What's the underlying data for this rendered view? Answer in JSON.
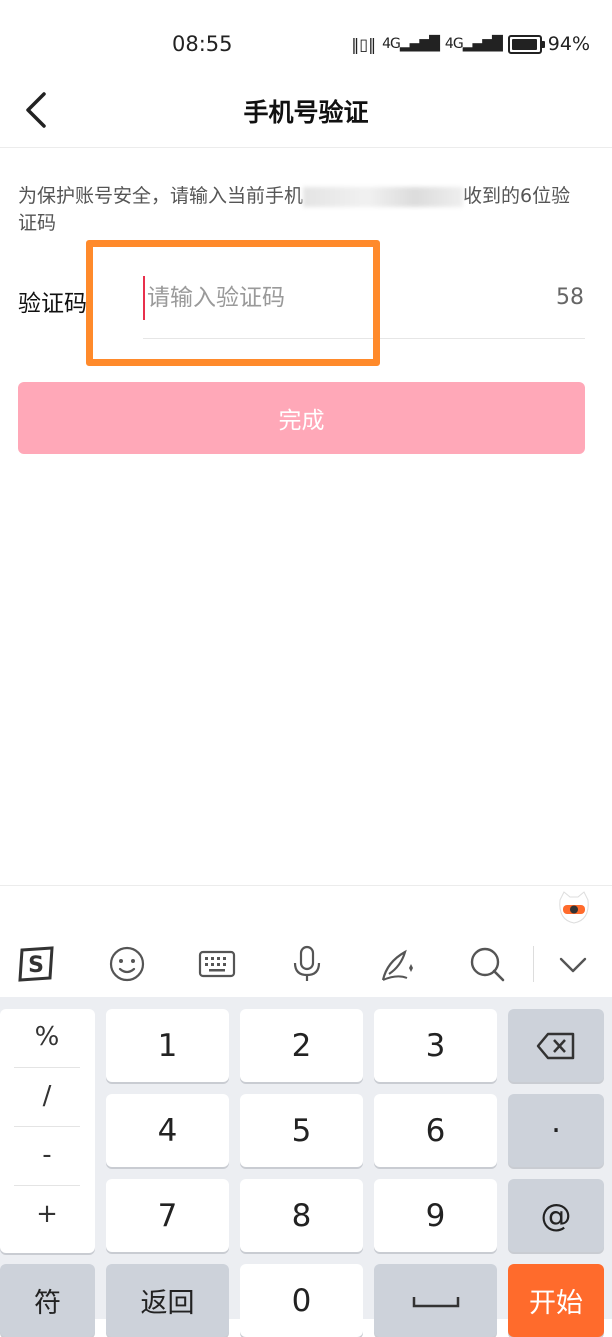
{
  "status_bar": {
    "time": "08:55",
    "network": "4G",
    "battery": "94%"
  },
  "header": {
    "title": "手机号验证"
  },
  "hint": {
    "prefix": "为保护账号安全，请输入当前手机",
    "suffix": "收到的6位验证码"
  },
  "code": {
    "label": "验证码",
    "placeholder": "请输入验证码",
    "value": "",
    "countdown": "58"
  },
  "done_button": {
    "label": "完成"
  },
  "colors": {
    "accent": "#ffa8b8",
    "highlight": "#ff8a2b",
    "keyboard_action": "#ff6b2c"
  },
  "keyboard": {
    "toolbar_icons": [
      "sogou-logo-icon",
      "emoji-icon",
      "keyboard-icon",
      "microphone-icon",
      "handwriting-icon",
      "search-icon",
      "chevron-down-icon"
    ],
    "symbols": [
      "%",
      "/",
      "-",
      "+"
    ],
    "digits": [
      "1",
      "2",
      "3",
      "4",
      "5",
      "6",
      "7",
      "8",
      "9",
      "0"
    ],
    "dot": "·",
    "at": "@",
    "symbol_key": "符",
    "back_key": "返回",
    "go_key": "开始"
  }
}
